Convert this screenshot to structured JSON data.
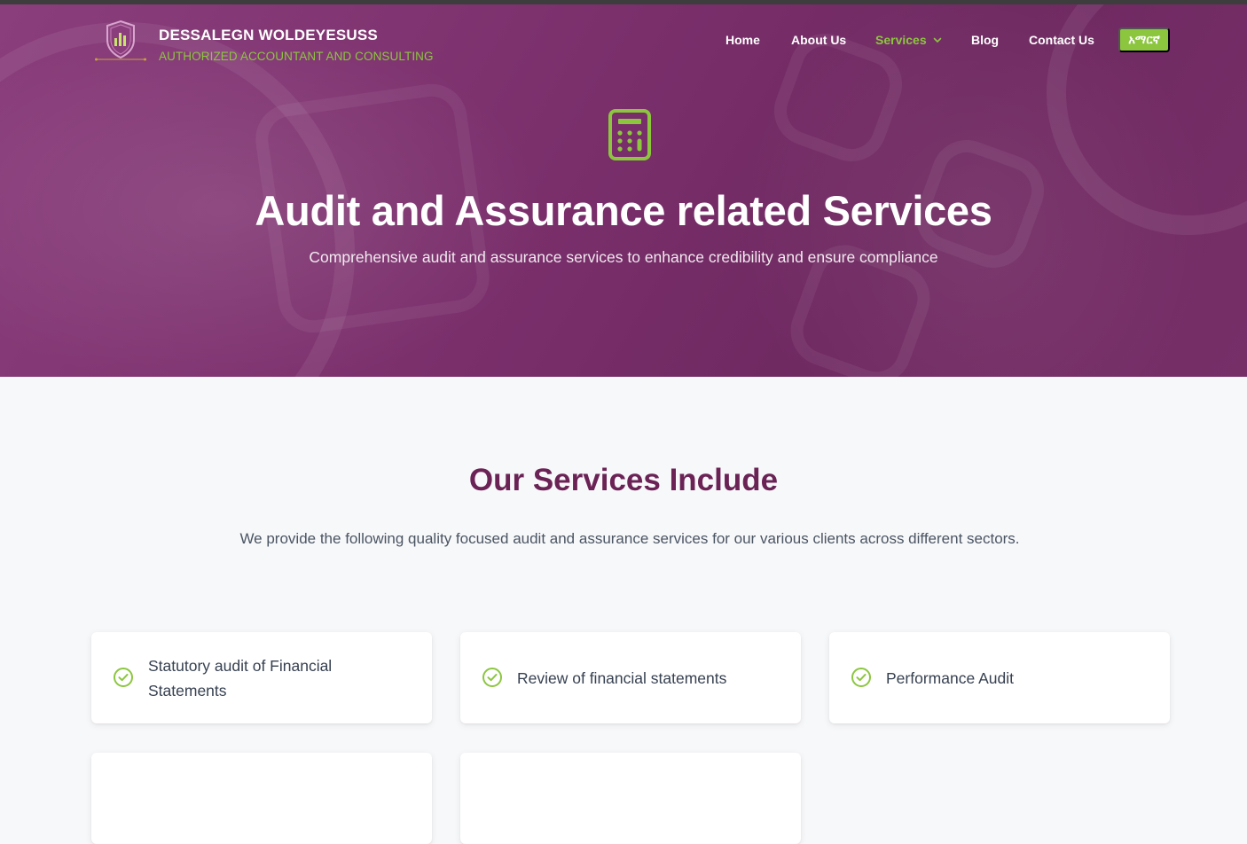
{
  "brand": {
    "name": "DESSALEGN WOLDEYESUSS",
    "tagline": "AUTHORIZED ACCOUNTANT AND CONSULTING",
    "logo_icon": "shield-chart-logo"
  },
  "nav": {
    "items": [
      {
        "label": "Home"
      },
      {
        "label": "About Us"
      },
      {
        "label": "Services",
        "active": true
      },
      {
        "label": "Blog"
      },
      {
        "label": "Contact Us"
      }
    ],
    "language_button": "አማርኛ"
  },
  "hero": {
    "icon": "calculator-icon",
    "title": "Audit and Assurance related Services",
    "subtitle": "Comprehensive audit and assurance services to enhance credibility and ensure compliance"
  },
  "services": {
    "title": "Our Services Include",
    "description": "We provide the following quality focused audit and assurance services for our various clients across different sectors.",
    "items": [
      {
        "label": "Statutory audit of Financial Statements"
      },
      {
        "label": "Review of financial statements"
      },
      {
        "label": "Performance Audit"
      }
    ]
  },
  "colors": {
    "primary": "#7a2f6b",
    "accent": "#8cc63f",
    "heading": "#6b2356"
  }
}
